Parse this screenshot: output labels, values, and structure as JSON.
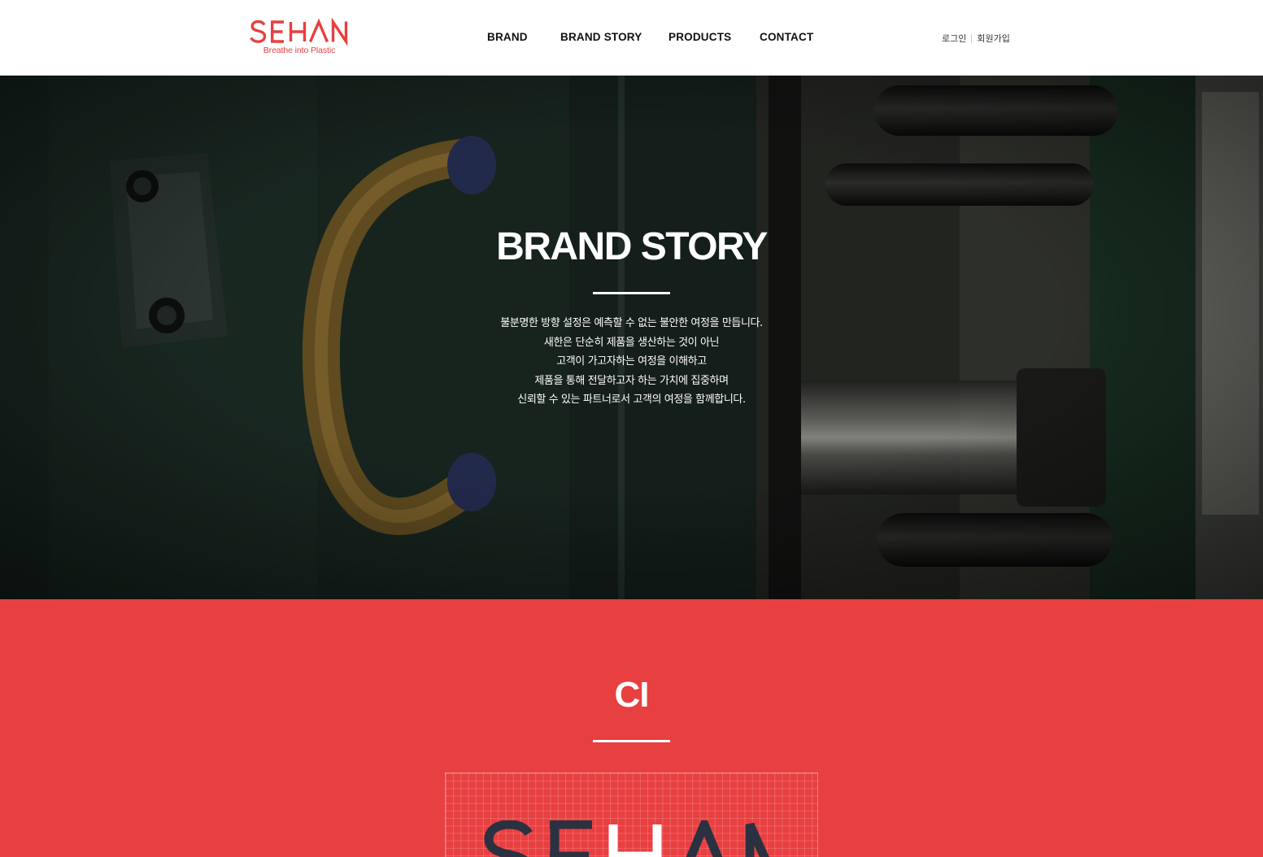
{
  "brand": {
    "logo_text": "SEHAN",
    "tagline": "Breathe into Plastic",
    "accent_color": "#e83f3f"
  },
  "nav": {
    "items": [
      {
        "label": "BRAND"
      },
      {
        "label": "BRAND STORY"
      },
      {
        "label": "PRODUCTS"
      },
      {
        "label": "CONTACT"
      }
    ]
  },
  "user_links": {
    "login": "로그인",
    "signup": "회원가입"
  },
  "hero": {
    "title": "BRAND STORY",
    "lines": [
      "불분명한 방향 설정은 예측할 수 없는 불안한 여정을 만듭니다.",
      "새한은 단순히 제품을 생산하는 것이 아닌",
      "고객이 가고자하는 여정을 이해하고",
      "제품을 통해 전달하고자 하는 가치에 집중하며",
      "신뢰할 수 있는 파트너로서 고객의 여정을 함께합니다."
    ]
  },
  "ci": {
    "title": "CI",
    "background_color": "#e83f40",
    "logo_text": "SEHAN",
    "logo_dark_color": "#2b3140"
  }
}
